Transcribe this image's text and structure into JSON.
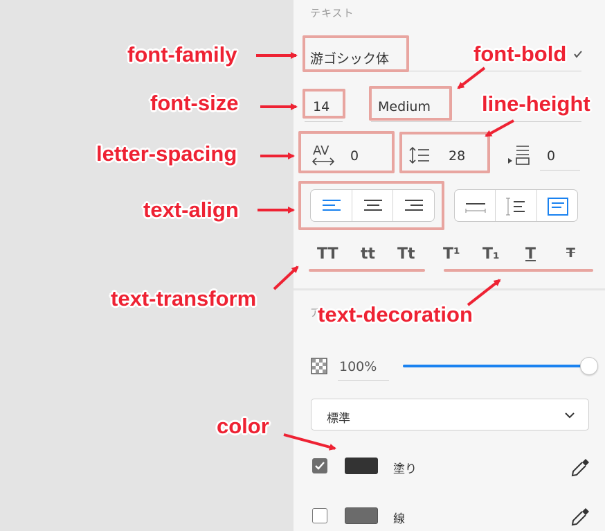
{
  "panel": {
    "section_title": "テキスト",
    "font_family_value": "游ゴシック体",
    "font_size_value": "14",
    "font_weight_value": "Medium",
    "letter_spacing_icon_text": "AV",
    "letter_spacing_value": "0",
    "line_height_value": "28",
    "paragraph_spacing_value": "0",
    "text_transform": [
      "TT",
      "tt",
      "Tt"
    ],
    "text_decoration": [
      "T¹",
      "T₁",
      "T",
      "T"
    ],
    "appearance_title_partial": "ア",
    "opacity_value": "100%",
    "opacity_level": 1.0,
    "blend_mode_value": "標準",
    "fill_label": "塗り",
    "fill_checked": true,
    "fill_color": "#333333",
    "stroke_label": "線",
    "stroke_checked": false,
    "stroke_color": "#6b6b6b",
    "accent_color": "#1a82f0"
  },
  "annotations": {
    "font_family": "font-family",
    "font_bold": "font-bold",
    "font_size": "font-size",
    "line_height": "line-height",
    "letter_spacing": "letter-spacing",
    "text_align": "text-align",
    "text_transform": "text-transform",
    "text_decoration": "text-decoration",
    "color": "color",
    "annotation_color": "#ee2233",
    "highlight_color": "#e8a5a0"
  }
}
